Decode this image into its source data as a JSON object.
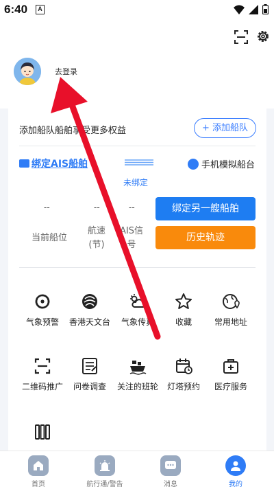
{
  "status_bar": {
    "time": "6:40",
    "notif_letter": "A"
  },
  "header": {
    "login_label": "去登录"
  },
  "fleet": {
    "promo_text": "添加船队船舶享受更多权益",
    "add_button": "+ 添加船队"
  },
  "ais": {
    "bind_label": "绑定AIS船舶",
    "status": "未绑定",
    "phone_sim_label": "手机模拟船台"
  },
  "stats": [
    {
      "value": "--",
      "label": "当前船位"
    },
    {
      "value": "--",
      "label": "航速(节)"
    },
    {
      "value": "--",
      "label": "AIS信号"
    }
  ],
  "actions": {
    "bind_another": "绑定另一艘船舶",
    "history": "历史轨迹"
  },
  "grid_row1": [
    {
      "label": "气象预警",
      "icon": "typhoon-icon"
    },
    {
      "label": "香港天文台",
      "icon": "observatory-icon"
    },
    {
      "label": "气象传真",
      "icon": "weather-icon"
    },
    {
      "label": "收藏",
      "icon": "star-icon"
    },
    {
      "label": "常用地址",
      "icon": "globe-pin-icon"
    }
  ],
  "grid_row2": [
    {
      "label": "二维码推广",
      "icon": "scan-icon"
    },
    {
      "label": "问卷调查",
      "icon": "survey-icon"
    },
    {
      "label": "关注的班轮",
      "icon": "ship-icon"
    },
    {
      "label": "灯塔预约",
      "icon": "calendar-icon"
    },
    {
      "label": "医疗服务",
      "icon": "medical-icon"
    }
  ],
  "grid_row3": [
    {
      "label": "",
      "icon": "columns-icon"
    }
  ],
  "bottom_nav": [
    {
      "label": "首页",
      "icon": "home-icon"
    },
    {
      "label": "航行通/警告",
      "icon": "alert-icon"
    },
    {
      "label": "消息",
      "icon": "message-icon"
    },
    {
      "label": "我的",
      "icon": "profile-icon"
    }
  ],
  "colors": {
    "accent": "#2f7cf6",
    "primary_button": "#1e7df2",
    "secondary_button": "#f98a0c",
    "annotation_arrow": "#e8102a"
  }
}
